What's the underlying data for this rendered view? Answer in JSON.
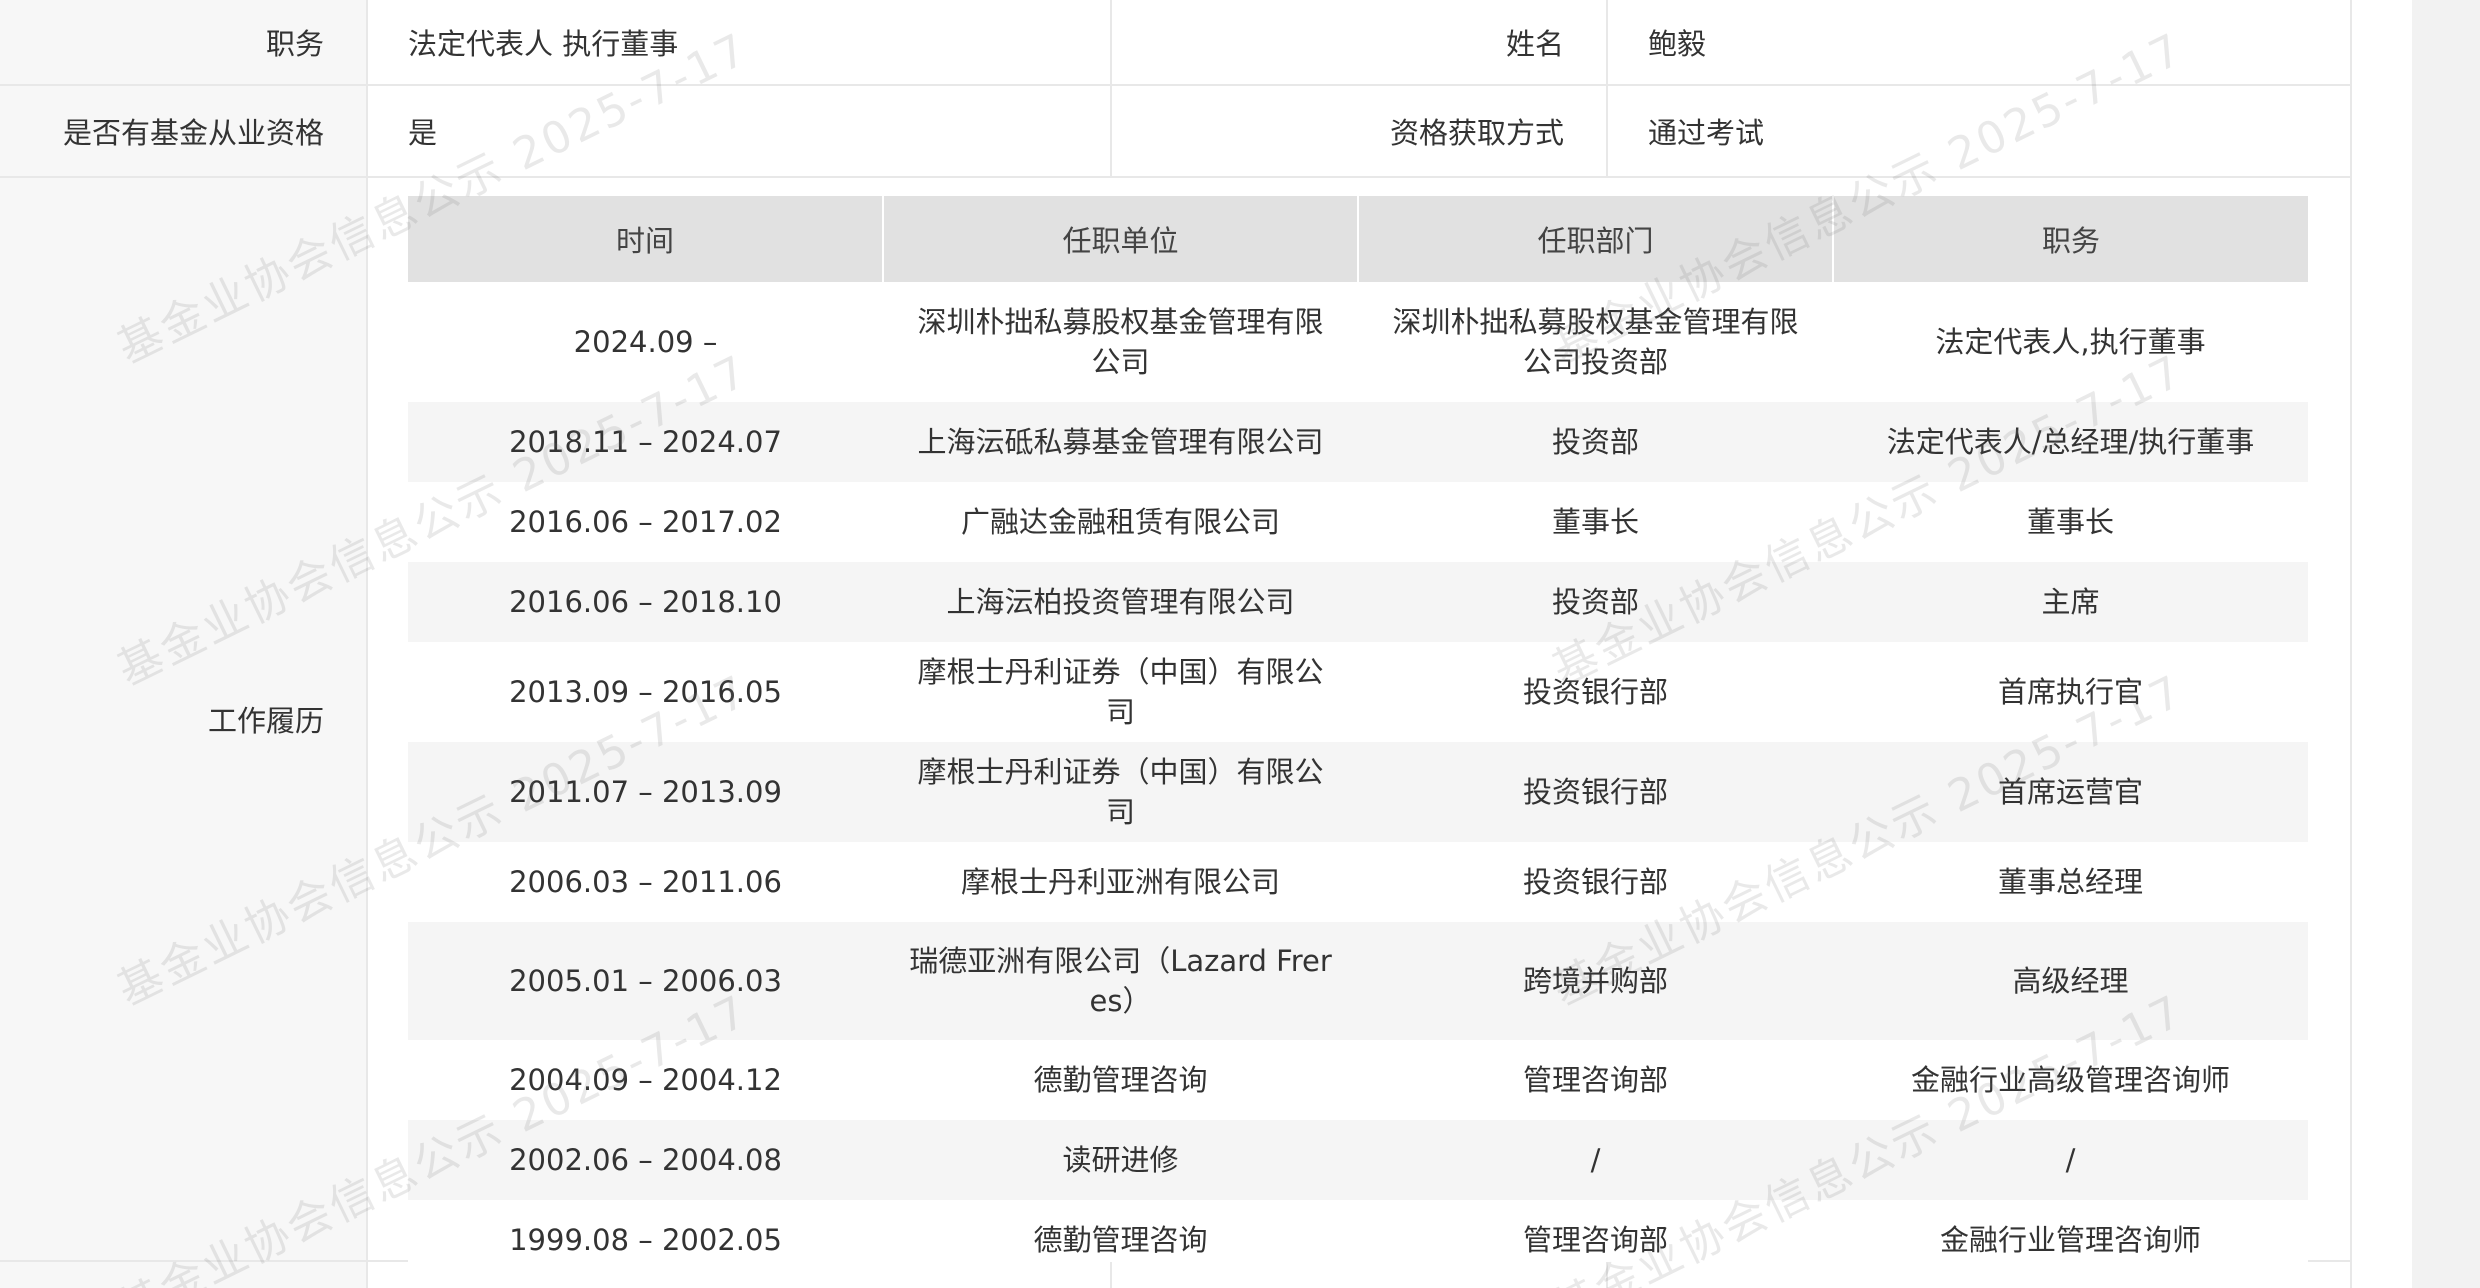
{
  "top_row": {
    "position_label": "职务",
    "position_value": "法定代表人 执行董事",
    "name_label": "姓名",
    "name_value": "鲍毅"
  },
  "second_row": {
    "qualification_label": "是否有基金从业资格",
    "qualification_value": "是",
    "method_label": "资格获取方式",
    "method_value": "通过考试"
  },
  "work_history": {
    "label": "工作履历",
    "columns": [
      "时间",
      "任职单位",
      "任职部门",
      "职务"
    ],
    "rows": [
      {
        "time": "2024.09 –",
        "org": "深圳朴拙私募股权基金管理有限公司",
        "dept": "深圳朴拙私募股权基金管理有限公司投资部",
        "title": "法定代表人,执行董事"
      },
      {
        "time": "2018.11 – 2024.07",
        "org": "上海沄砥私募基金管理有限公司",
        "dept": "投资部",
        "title": "法定代表人/总经理/执行董事"
      },
      {
        "time": "2016.06 – 2017.02",
        "org": "广融达金融租赁有限公司",
        "dept": "董事长",
        "title": "董事长"
      },
      {
        "time": "2016.06 – 2018.10",
        "org": "上海沄柏投资管理有限公司",
        "dept": "投资部",
        "title": "主席"
      },
      {
        "time": "2013.09 – 2016.05",
        "org": "摩根士丹利证券（中国）有限公司",
        "dept": "投资银行部",
        "title": "首席执行官"
      },
      {
        "time": "2011.07 – 2013.09",
        "org": "摩根士丹利证券（中国）有限公司",
        "dept": "投资银行部",
        "title": "首席运营官"
      },
      {
        "time": "2006.03 – 2011.06",
        "org": "摩根士丹利亚洲有限公司",
        "dept": "投资银行部",
        "title": "董事总经理"
      },
      {
        "time": "2005.01 – 2006.03",
        "org": "瑞德亚洲有限公司（Lazard Freres）",
        "dept": "跨境并购部",
        "title": "高级经理"
      },
      {
        "time": "2004.09 – 2004.12",
        "org": "德勤管理咨询",
        "dept": "管理咨询部",
        "title": "金融行业高级管理咨询师"
      },
      {
        "time": "2002.06 – 2004.08",
        "org": "读研进修",
        "dept": "/",
        "title": "/"
      },
      {
        "time": "1999.08 – 2002.05",
        "org": "德勤管理咨询",
        "dept": "管理咨询部",
        "title": "金融行业管理咨询师"
      }
    ]
  },
  "watermark": {
    "text": "基金业协会信息公示 2025-7-17"
  }
}
